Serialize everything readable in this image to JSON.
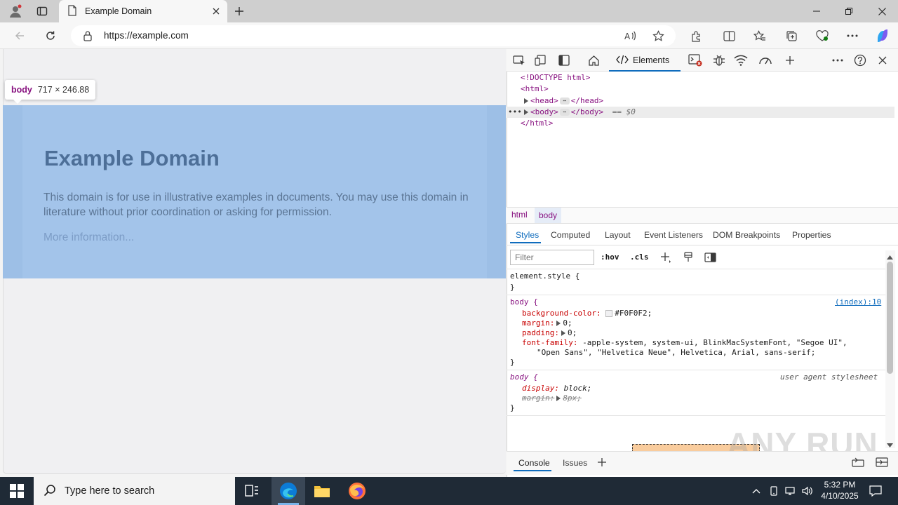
{
  "browser": {
    "tab": {
      "title": "Example Domain",
      "close_icon": "close-icon"
    },
    "new_tab_icon": "plus-icon",
    "address": {
      "url": "https://example.com"
    },
    "window_controls": [
      "minimize",
      "restore",
      "close"
    ]
  },
  "page": {
    "heading": "Example Domain",
    "paragraph": "This domain is for use in illustrative examples in documents. You may use this domain in literature without prior coordination or asking for permission.",
    "link": "More information...",
    "background": "#f0f0f2",
    "highlight_color": "#9dbfe6"
  },
  "inspect_tooltip": {
    "tag": "body",
    "dimensions": "717 × 246.88"
  },
  "devtools": {
    "active_tab": "Elements",
    "dom": {
      "doctype": "<!DOCTYPE html>",
      "html_open": "<html>",
      "head_open": "<head>",
      "head_close": "</head>",
      "body_open": "<body>",
      "body_close": "</body>",
      "selected_marker": "== $0",
      "html_close": "</html>",
      "ellipsis": "⋯",
      "row_dots": "•••"
    },
    "breadcrumbs": [
      "html",
      "body"
    ],
    "subtabs": [
      "Styles",
      "Computed",
      "Layout",
      "Event Listeners",
      "DOM Breakpoints",
      "Properties"
    ],
    "filter_placeholder": "Filter",
    "filter_buttons": [
      ":hov",
      ".cls"
    ],
    "styles": {
      "element_style_selector": "element.style {",
      "close_brace": "}",
      "rule1_selector": "body {",
      "rule1_source": "(index):10",
      "rule1_props": [
        {
          "name": "background-color:",
          "value": "#F0F0F2;"
        },
        {
          "name": "margin:",
          "value": "0;"
        },
        {
          "name": "padding:",
          "value": "0;"
        },
        {
          "name": "font-family:",
          "value": "-apple-system, system-ui, BlinkMacSystemFont, \"Segoe UI\","
        }
      ],
      "rule1_font_cont": "\"Open Sans\", \"Helvetica Neue\", Helvetica, Arial, sans-serif;",
      "rule2_selector": "body {",
      "rule2_source": "user agent stylesheet",
      "rule2_props": [
        {
          "name": "display:",
          "value": "block;"
        },
        {
          "name": "margin:",
          "value": "8px;"
        }
      ]
    },
    "drawer_tabs": [
      "Console",
      "Issues"
    ]
  },
  "watermark": "ANY RUN",
  "taskbar": {
    "search_placeholder": "Type here to search",
    "time": "5:32 PM",
    "date": "4/10/2025"
  }
}
